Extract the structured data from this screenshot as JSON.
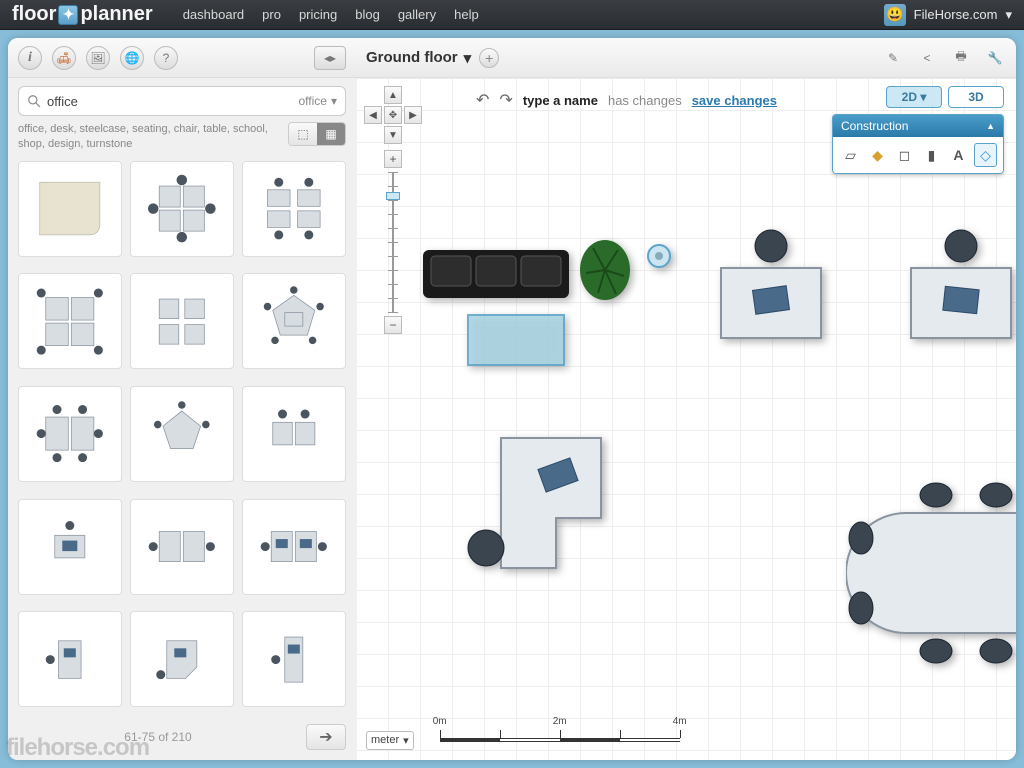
{
  "brand": {
    "part1": "floor",
    "part2": "planner"
  },
  "nav": {
    "dashboard": "dashboard",
    "pro": "pro",
    "pricing": "pricing",
    "blog": "blog",
    "gallery": "gallery",
    "help": "help"
  },
  "user": {
    "name": "FileHorse.com"
  },
  "sidebar": {
    "search_value": "office",
    "category": "office",
    "tags": "office, desk, steelcase, seating, chair, table, school, shop, design, turnstone",
    "page_label": "61-75 of 210"
  },
  "canvas": {
    "floor_name": "Ground floor",
    "name_placeholder": "type a name",
    "status": "has changes",
    "save": "save changes",
    "view2d": "2D",
    "view3d": "3D",
    "construction_title": "Construction",
    "unit": "meter",
    "scale": {
      "s0": "0m",
      "s2": "2m",
      "s4": "4m"
    }
  },
  "watermark": "filehorse.com"
}
